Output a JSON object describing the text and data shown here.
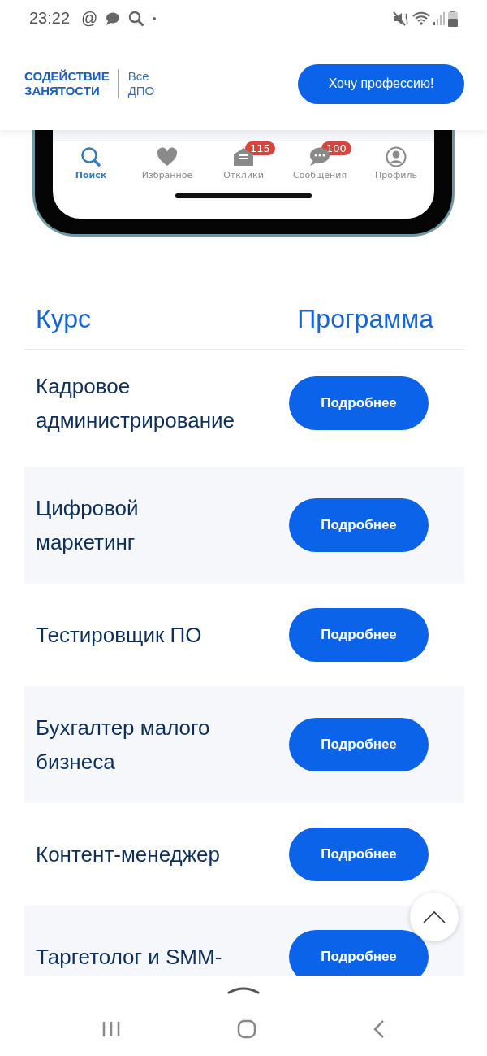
{
  "status_bar": {
    "time": "23:22",
    "at_sign": "@"
  },
  "header": {
    "logo_line1": "СОДЕЙСТВИЕ",
    "logo_line2": "ЗАНЯТОСТИ",
    "section_line1": "Все",
    "section_line2": "ДПО",
    "cta": "Хочу профессию!"
  },
  "phone_preview": {
    "tabs": [
      {
        "label": "Поиск",
        "selected": true
      },
      {
        "label": "Избранное",
        "selected": false
      },
      {
        "label": "Отклики",
        "badge": "115",
        "selected": false
      },
      {
        "label": "Сообщения",
        "badge": "100",
        "selected": false
      },
      {
        "label": "Профиль",
        "selected": false
      }
    ]
  },
  "table": {
    "columns": [
      "Курс",
      "Программа"
    ],
    "rows": [
      {
        "course": "Кадровое администрирование",
        "button": "Подробнее"
      },
      {
        "course": "Цифровой маркетинг",
        "button": "Подробнее"
      },
      {
        "course": "Тестировщик ПО",
        "button": "Подробнее"
      },
      {
        "course": "Бухгалтер малого бизнеса",
        "button": "Подробнее"
      },
      {
        "course": "Контент-менеджер",
        "button": "Подробнее"
      },
      {
        "course": "Таргетолог и SMM-",
        "button": "Подробнее"
      }
    ]
  }
}
